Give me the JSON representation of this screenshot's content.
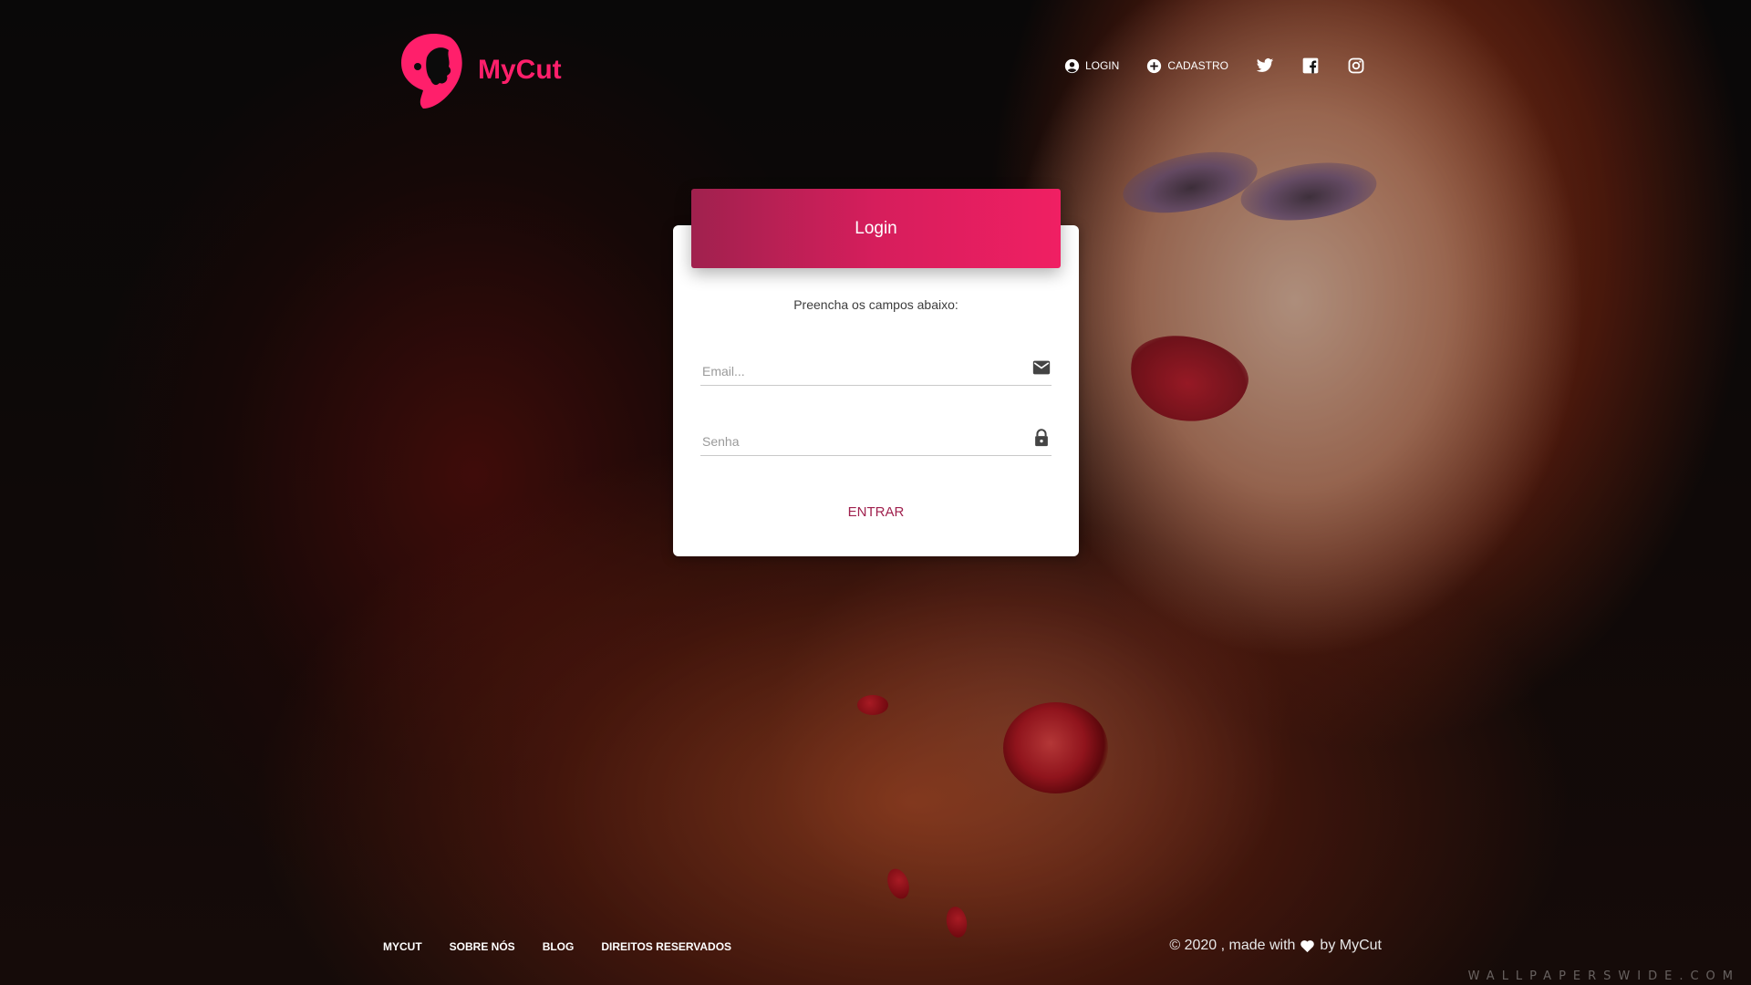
{
  "brand": {
    "name": "MyCut",
    "color": "#ff1f6b"
  },
  "nav": {
    "login_label": "LOGIN",
    "login_icon": "user-circle-icon",
    "signup_label": "CADASTRO",
    "signup_icon": "plus-circle-icon",
    "social": [
      "twitter-icon",
      "facebook-icon",
      "instagram-icon"
    ]
  },
  "login_card": {
    "title": "Login",
    "subtitle": "Preencha os campos abaixo:",
    "email_placeholder": "Email...",
    "email_icon": "mail-icon",
    "password_placeholder": "Senha",
    "password_icon": "lock-icon",
    "submit_label": "ENTRAR",
    "header_gradient": [
      "#a0214e",
      "#f01f63"
    ]
  },
  "footer": {
    "links": [
      "MYCUT",
      "SOBRE NÓS",
      "BLOG",
      "DIREITOS RESERVADOS"
    ],
    "copyright_prefix": "© 2020 , made with",
    "copyright_suffix": "by MyCut"
  },
  "watermark": "WALLPAPERSWIDE.COM"
}
